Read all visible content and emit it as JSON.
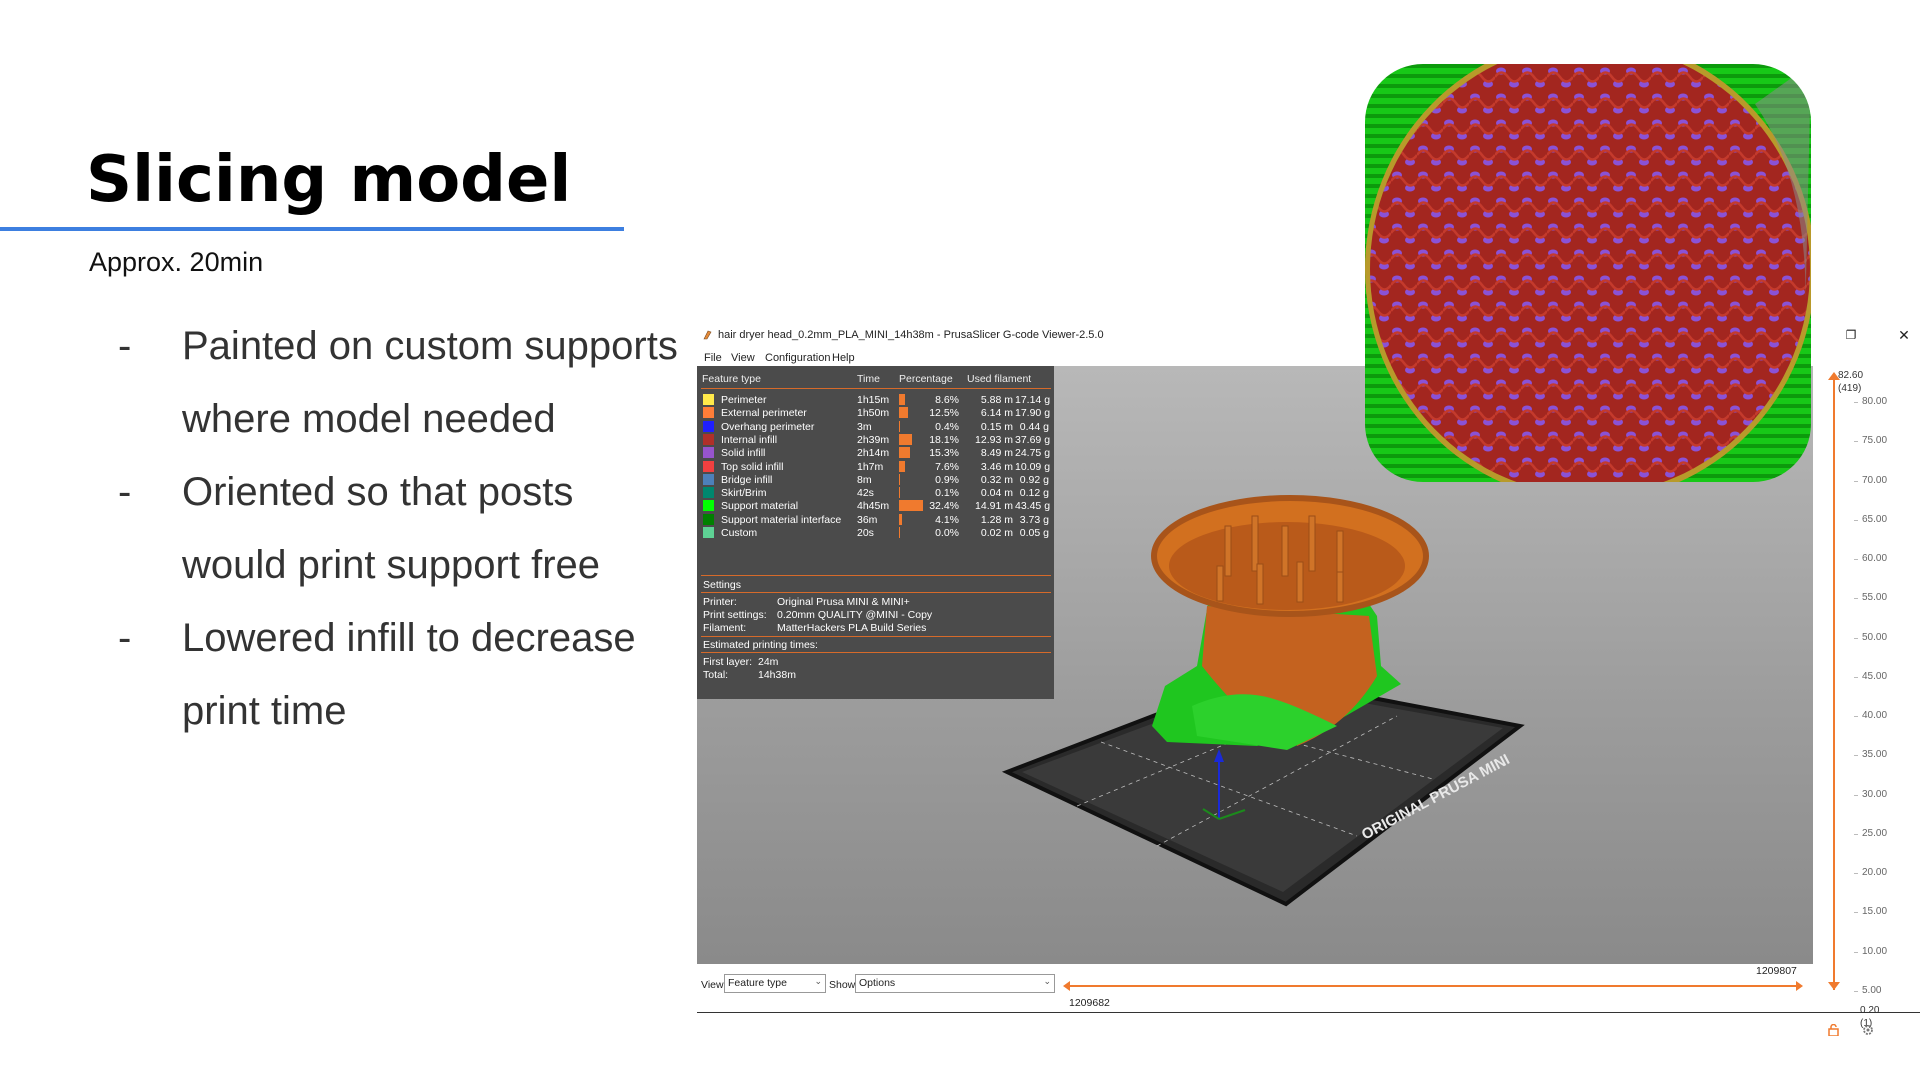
{
  "slide": {
    "title": "Slicing model",
    "subtitle": "Approx. 20min",
    "bullets": [
      "Painted on custom supports where model needed",
      "Oriented so that posts would print support free",
      "Lowered infill to decrease print time"
    ],
    "bullet_marker": "-",
    "accent_color": "#3d7fe0"
  },
  "window": {
    "title": "hair dryer head_0.2mm_PLA_MINI_14h38m - PrusaSlicer G-code Viewer-2.5.0",
    "restore_icon": "restore-icon",
    "close_icon": "close-icon",
    "close_glyph": "✕",
    "restore_glyph": "❐"
  },
  "menu": [
    "File",
    "View",
    "Configuration",
    "Help"
  ],
  "legend": {
    "headers": {
      "feature": "Feature type",
      "time": "Time",
      "percentage": "Percentage",
      "filament": "Used filament"
    },
    "rows": [
      {
        "name": "Perimeter",
        "time": "1h15m",
        "pct": "8.6%",
        "pct_value": 8.6,
        "length": "5.88 m",
        "weight": "17.14 g",
        "color": "#ffe94a"
      },
      {
        "name": "External perimeter",
        "time": "1h50m",
        "pct": "12.5%",
        "pct_value": 12.5,
        "length": "6.14 m",
        "weight": "17.90 g",
        "color": "#ff7d38"
      },
      {
        "name": "Overhang perimeter",
        "time": "3m",
        "pct": "0.4%",
        "pct_value": 0.4,
        "length": "0.15 m",
        "weight": "0.44 g",
        "color": "#1f1fff"
      },
      {
        "name": "Internal infill",
        "time": "2h39m",
        "pct": "18.1%",
        "pct_value": 18.1,
        "length": "12.93 m",
        "weight": "37.69 g",
        "color": "#b03029"
      },
      {
        "name": "Solid infill",
        "time": "2h14m",
        "pct": "15.3%",
        "pct_value": 15.3,
        "length": "8.49 m",
        "weight": "24.75 g",
        "color": "#9654cc"
      },
      {
        "name": "Top solid infill",
        "time": "1h7m",
        "pct": "7.6%",
        "pct_value": 7.6,
        "length": "3.46 m",
        "weight": "10.09 g",
        "color": "#f04040"
      },
      {
        "name": "Bridge infill",
        "time": "8m",
        "pct": "0.9%",
        "pct_value": 0.9,
        "length": "0.32 m",
        "weight": "0.92 g",
        "color": "#4d80ba"
      },
      {
        "name": "Skirt/Brim",
        "time": "42s",
        "pct": "0.1%",
        "pct_value": 0.1,
        "length": "0.04 m",
        "weight": "0.12 g",
        "color": "#00876e"
      },
      {
        "name": "Support material",
        "time": "4h45m",
        "pct": "32.4%",
        "pct_value": 32.4,
        "length": "14.91 m",
        "weight": "43.45 g",
        "color": "#00ff00"
      },
      {
        "name": "Support material interface",
        "time": "36m",
        "pct": "4.1%",
        "pct_value": 4.1,
        "length": "1.28 m",
        "weight": "3.73 g",
        "color": "#008000"
      },
      {
        "name": "Custom",
        "time": "20s",
        "pct": "0.0%",
        "pct_value": 0.0,
        "length": "0.02 m",
        "weight": "0.05 g",
        "color": "#5ed194"
      }
    ],
    "settings_header": "Settings",
    "settings": [
      {
        "key": "Printer:",
        "value": "Original Prusa MINI & MINI+"
      },
      {
        "key": "Print settings:",
        "value": "0.20mm QUALITY @MINI - Copy"
      },
      {
        "key": "Filament:",
        "value": "MatterHackers PLA Build Series"
      }
    ],
    "estimated_header": "Estimated printing times:",
    "times": [
      {
        "key": "First layer:",
        "value": "24m"
      },
      {
        "key": "Total:",
        "value": "14h38m"
      }
    ],
    "bar_color": "#f07a2e"
  },
  "bed_label": "ORIGINAL PRUSA MINI",
  "vertical_slider": {
    "top_value": "82.60",
    "top_layer": "(419)",
    "bottom_value": "0.20",
    "bottom_layer": "(1)",
    "ticks": [
      "80.00",
      "75.00",
      "70.00",
      "65.00",
      "60.00",
      "55.00",
      "50.00",
      "45.00",
      "40.00",
      "35.00",
      "30.00",
      "25.00",
      "20.00",
      "15.00",
      "10.00",
      "5.00"
    ],
    "lock_icon": "lock-icon",
    "settings_icon": "gear-icon"
  },
  "bottom": {
    "view_label": "View",
    "view_value": "Feature type",
    "show_label": "Show",
    "show_value": "Options",
    "range_start": "1209682",
    "range_end": "1209807"
  }
}
